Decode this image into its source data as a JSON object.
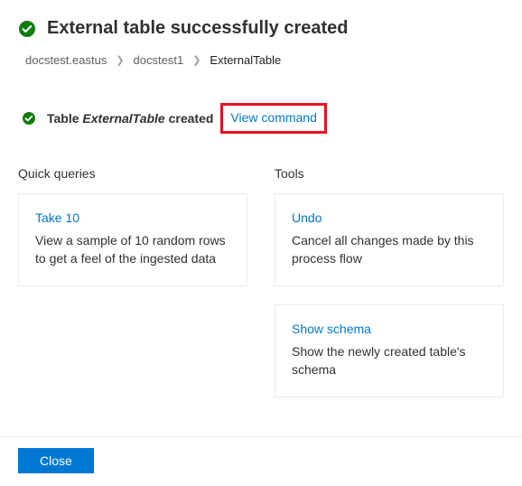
{
  "header": {
    "title": "External table successfully created"
  },
  "breadcrumb": {
    "items": [
      "docstest.eastus",
      "docstest1",
      "ExternalTable"
    ]
  },
  "status": {
    "prefix": "Table ",
    "table_name": "ExternalTable",
    "suffix": " created",
    "view_command_label": "View command"
  },
  "sections": {
    "quick_queries": {
      "title": "Quick queries",
      "cards": [
        {
          "title": "Take 10",
          "desc": "View a sample of 10 random rows to get a feel of the ingested data"
        }
      ]
    },
    "tools": {
      "title": "Tools",
      "cards": [
        {
          "title": "Undo",
          "desc": "Cancel all changes made by this process flow"
        },
        {
          "title": "Show schema",
          "desc": "Show the newly created table's schema"
        }
      ]
    }
  },
  "footer": {
    "close_label": "Close"
  },
  "colors": {
    "accent": "#0078d4",
    "success": "#107c10",
    "highlight": "#e81123"
  }
}
